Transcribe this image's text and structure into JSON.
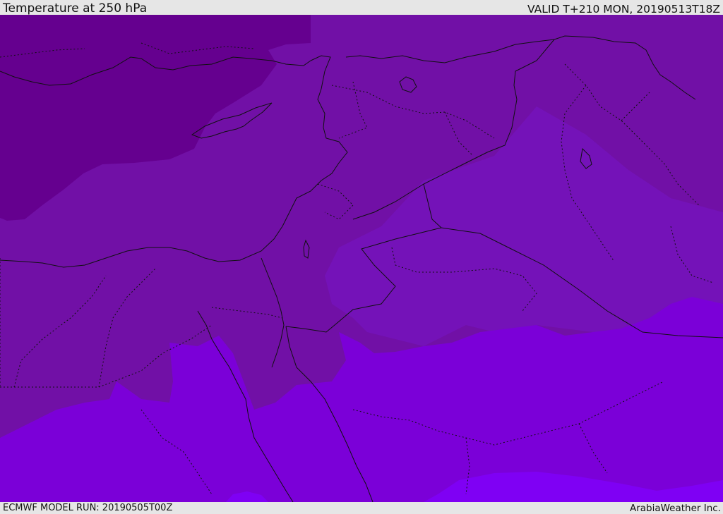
{
  "header": {
    "title": "Temperature at 250 hPa",
    "valid": "VALID T+210 MON, 20190513T18Z"
  },
  "footer": {
    "model_run": "ECMWF MODEL RUN: 20190505T00Z",
    "credit": "ArabiaWeather Inc."
  },
  "map": {
    "colors": {
      "coldest": "#65008f",
      "cold": "#7110a6",
      "mid": "#7412b8",
      "warm": "#7b00d8",
      "warmest": "#7f00f4",
      "boundary": "#101010"
    }
  }
}
